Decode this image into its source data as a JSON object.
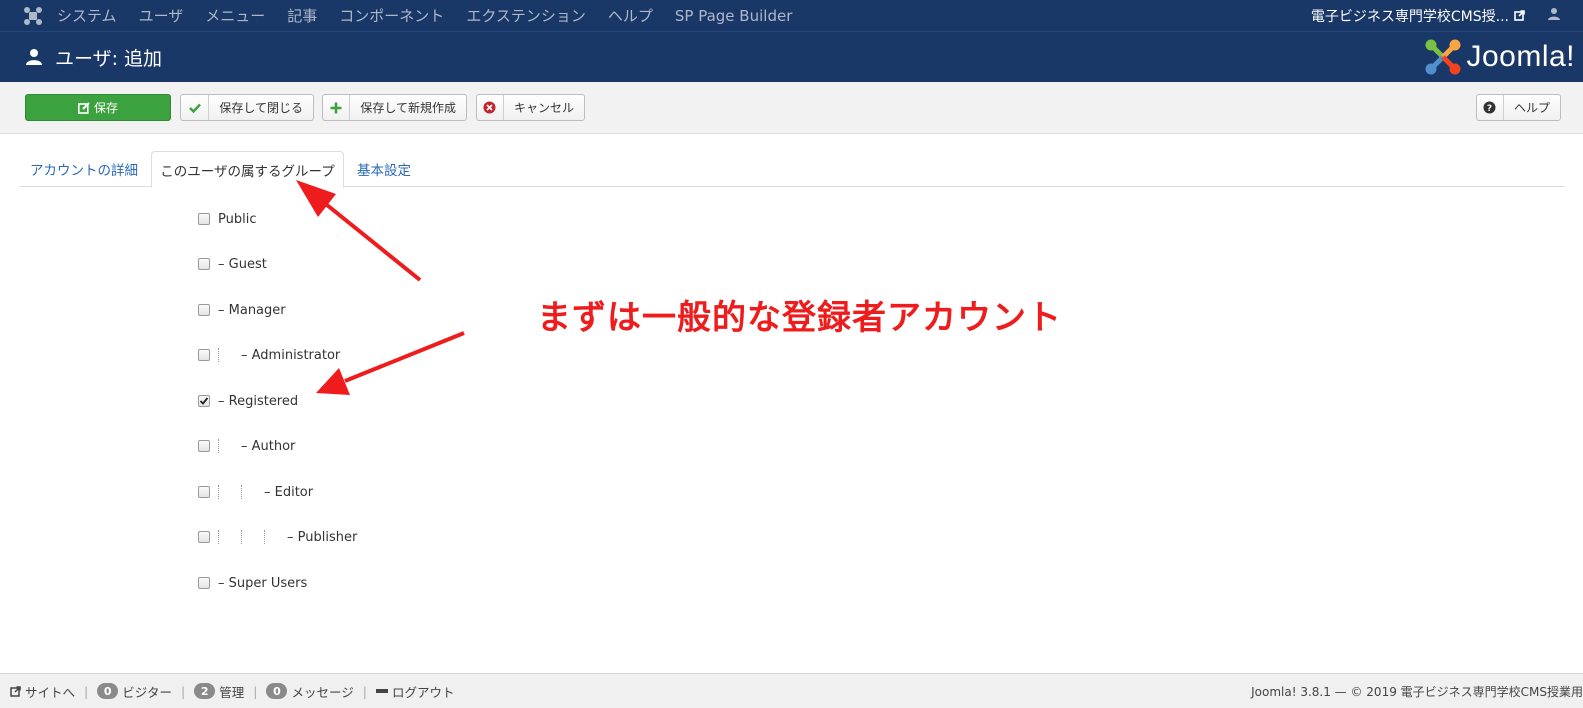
{
  "topnav": {
    "menu": [
      "システム",
      "ユーザ",
      "メニュー",
      "記事",
      "コンポーネント",
      "エクステンション",
      "ヘルプ",
      "SP Page Builder"
    ],
    "site_name": "電子ビジネス専門学校CMS授..."
  },
  "header": {
    "title": "ユーザ: 追加",
    "brand": "Joomla!"
  },
  "toolbar": {
    "save": "保存",
    "save_close": "保存して閉じる",
    "save_new": "保存して新規作成",
    "cancel": "キャンセル",
    "help": "ヘルプ"
  },
  "tabs": [
    {
      "label": "アカウントの詳細",
      "active": false
    },
    {
      "label": "このユーザの属するグループ",
      "active": true
    },
    {
      "label": "基本設定",
      "active": false
    }
  ],
  "groups": [
    {
      "label": "Public",
      "checked": false
    },
    {
      "label": "– Guest",
      "checked": false
    },
    {
      "label": "– Manager",
      "checked": false
    },
    {
      "label": "– Administrator",
      "checked": false
    },
    {
      "label": "– Registered",
      "checked": true
    },
    {
      "label": "– Author",
      "checked": false
    },
    {
      "label": "– Editor",
      "checked": false
    },
    {
      "label": "– Publisher",
      "checked": false
    },
    {
      "label": "– Super Users",
      "checked": false
    }
  ],
  "annotation": {
    "text": "まずは一般的な登録者アカウント",
    "color": "#ee1c1c"
  },
  "statusbar": {
    "site": "サイトへ",
    "visitors_count": "0",
    "visitors": "ビジター",
    "admins_count": "2",
    "admins": "管理",
    "messages_count": "0",
    "messages": "メッセージ",
    "logout": "ログアウト",
    "copyright": "Joomla! 3.8.1 — © 2019 電子ビジネス専門学校CMS授業用"
  },
  "colors": {
    "header_bg": "#1a3867",
    "save_green": "#3ba23f",
    "link_blue": "#2a69b8"
  }
}
